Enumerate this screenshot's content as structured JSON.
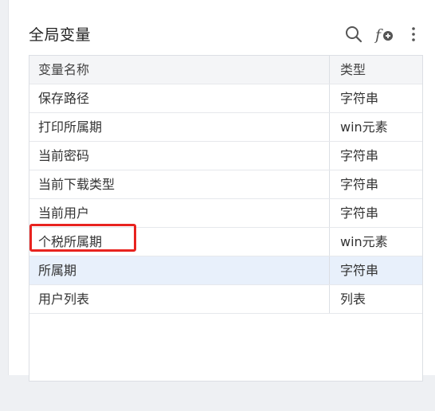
{
  "panel": {
    "title": "全局变量",
    "icons": {
      "search": "search-icon",
      "function": "function-add-icon",
      "more": "more-vertical-icon"
    }
  },
  "table": {
    "columns": [
      "变量名称",
      "类型"
    ],
    "rows": [
      {
        "name": "保存路径",
        "type": "字符串"
      },
      {
        "name": "打印所属期",
        "type": "win元素"
      },
      {
        "name": "当前密码",
        "type": "字符串"
      },
      {
        "name": "当前下载类型",
        "type": "字符串"
      },
      {
        "name": "当前用户",
        "type": "字符串"
      },
      {
        "name": "个税所属期",
        "type": "win元素"
      },
      {
        "name": "所属期",
        "type": "字符串"
      },
      {
        "name": "用户列表",
        "type": "列表"
      }
    ],
    "selected_row": "所属期"
  },
  "colors": {
    "highlight_box": "#e8231f",
    "selected_row_bg": "#e8f0fb"
  }
}
